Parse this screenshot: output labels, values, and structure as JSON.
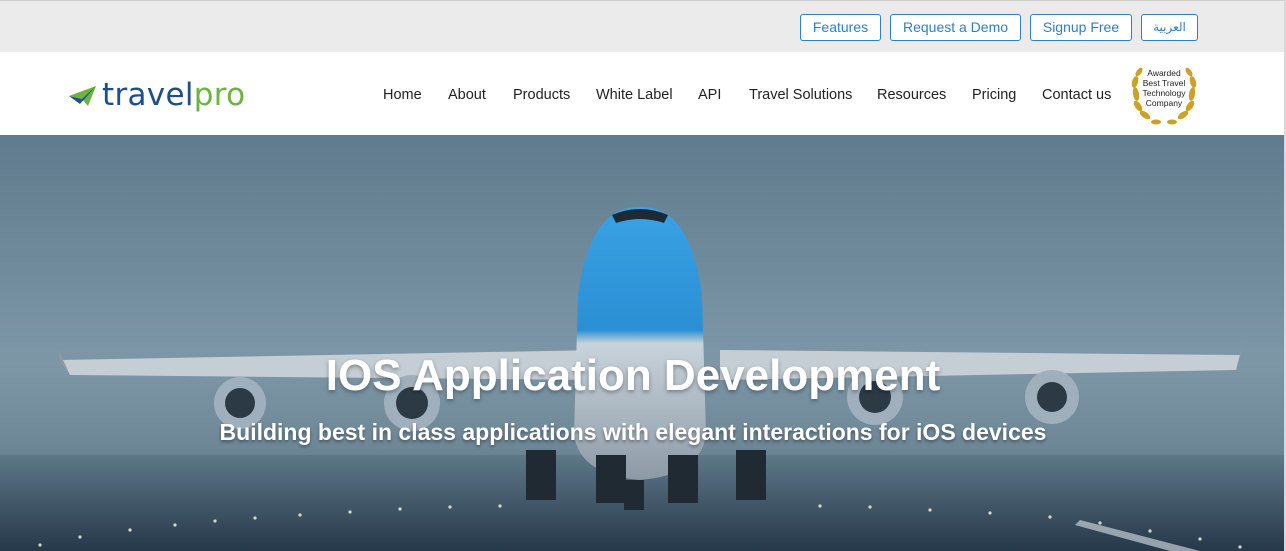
{
  "topbar": {
    "features": "Features",
    "request_demo": "Request a Demo",
    "signup": "Signup Free",
    "arabic": "العربية"
  },
  "logo": {
    "part1": "travel",
    "part2": "pro"
  },
  "nav": {
    "home": "Home",
    "about": "About",
    "products": "Products",
    "white_label": "White Label",
    "api": "API",
    "travel_solutions": "Travel Solutions",
    "resources": "Resources",
    "pricing": "Pricing",
    "contact": "Contact us"
  },
  "award": {
    "line1": "Awarded",
    "line2": "Best Travel",
    "line3": "Technology",
    "line4": "Company"
  },
  "hero": {
    "title": "IOS Application Development",
    "subtitle": "Building best in class applications with elegant interactions for iOS devices"
  },
  "colors": {
    "accent": "#2f7fc4",
    "logo_blue": "#1e4f8c",
    "logo_green": "#6cb33f",
    "topbar_bg": "#ebebeb"
  },
  "icons": {
    "logo_mark": "paper-plane-icon",
    "award_badge": "laurel-wreath-icon"
  }
}
